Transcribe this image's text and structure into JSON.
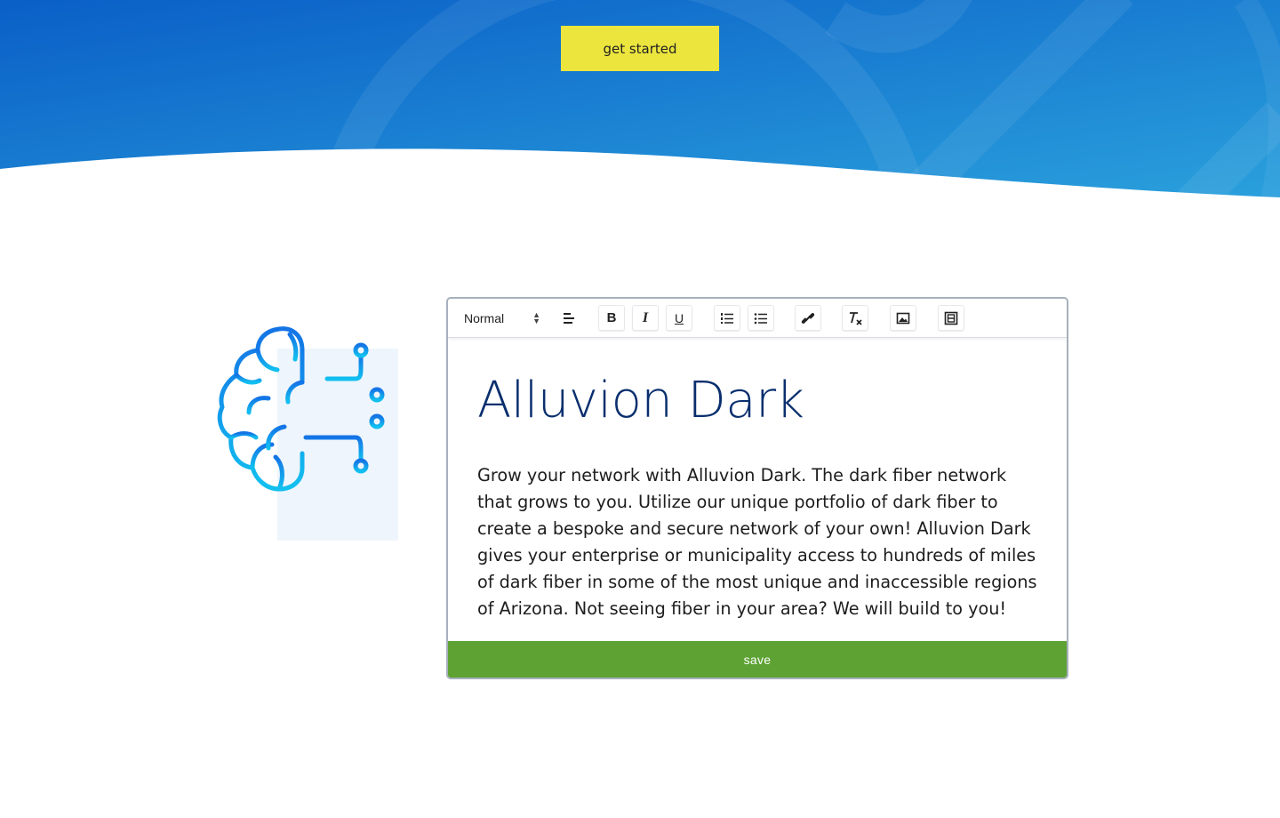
{
  "hero": {
    "cta_label": "get started",
    "gradient_start": "#0a5fc7",
    "gradient_end": "#2aa0dc"
  },
  "illustration": {
    "icon": "brain-circuit-icon",
    "stroke_start": "#1474e6",
    "stroke_end": "#12c0ef",
    "panel_color": "#eef5fd"
  },
  "editor": {
    "toolbar": {
      "format_value": "Normal",
      "icons": [
        "align-left-icon",
        "bold-icon",
        "italic-icon",
        "underline-icon",
        "ordered-list-icon",
        "bullet-list-icon",
        "link-icon",
        "clear-format-icon",
        "image-icon",
        "video-icon"
      ],
      "bold_glyph": "B",
      "italic_glyph": "I",
      "underline_glyph": "U"
    },
    "content": {
      "title": "Alluvion Dark",
      "body": "Grow your network with Alluvion Dark. The dark fiber network that grows to you. Utilize our unique portfolio of dark fiber to create a bespoke and secure network of your own! Alluvion Dark gives your enterprise or municipality access to hundreds of miles of dark fiber in some of the most unique and inaccessible regions of Arizona. Not seeing fiber in your area? We will build to you!"
    },
    "save_label": "save",
    "save_color": "#5da232"
  }
}
